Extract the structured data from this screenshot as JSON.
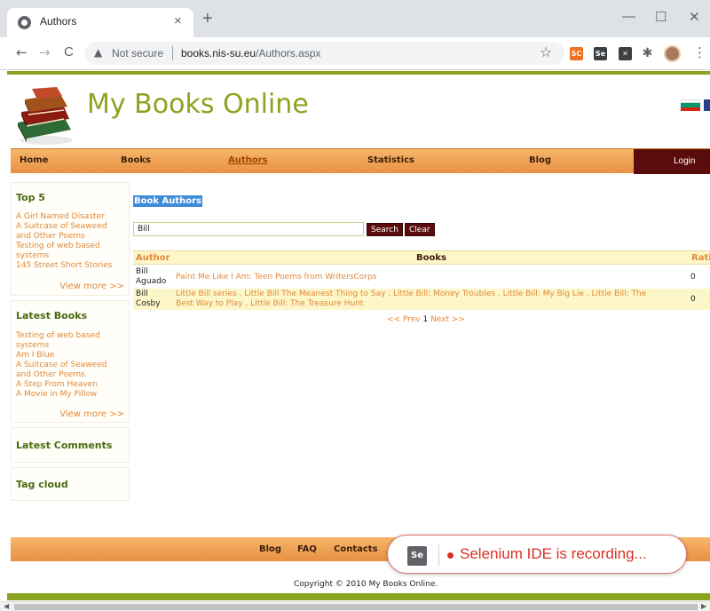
{
  "browser": {
    "tab_title": "Authors",
    "tab_close": "×",
    "new_tab": "+",
    "win_minimize": "—",
    "win_maximize": "☐",
    "win_close": "✕",
    "back": "←",
    "forward": "→",
    "reload": "C",
    "security_label": "Not secure",
    "url_host": "books.nis-su.eu",
    "url_path": "/Authors.aspx",
    "extensions": [
      {
        "name": "sc-extension-icon",
        "label": "SC",
        "color": "#f36f21"
      },
      {
        "name": "selenium-extension-icon",
        "label": "Se",
        "color": "#3c4043"
      },
      {
        "name": "x-extension-icon",
        "label": "✕",
        "color": "#3c4043"
      }
    ]
  },
  "site": {
    "title": "My Books Online",
    "accent_color": "#8aa422"
  },
  "nav": {
    "items": [
      "Home",
      "Books",
      "Authors",
      "Statistics",
      "Blog"
    ],
    "active": "Authors",
    "login": "Login"
  },
  "sidebar": {
    "top5": {
      "title": "Top 5",
      "links": [
        "A Girl Named Disaster",
        "A Suitcase of Seaweed",
        "and Other Poems",
        "Testing of web based",
        "systems",
        "145 Street Short Stories"
      ],
      "view_more": "View more >>"
    },
    "latest_books": {
      "title": "Latest Books",
      "links": [
        "Testing of web based",
        "systems",
        "Am I Blue",
        "A Suitcase of Seaweed",
        "and Other Poems",
        "A Step From Heaven",
        "A Movie in My Pillow"
      ],
      "view_more": "View more >>"
    },
    "latest_comments": {
      "title": "Latest Comments"
    },
    "tag_cloud": {
      "title": "Tag cloud"
    }
  },
  "main": {
    "title": "Book Authors",
    "search_value": "Bill",
    "search_button": "Search",
    "clear_button": "Clear",
    "columns": {
      "author": "Author",
      "books": "Books",
      "rating": "Rati"
    },
    "rows": [
      {
        "author_line1": "Bill",
        "author_line2": "Aguado",
        "books_line1": "Paint Me Like I Am: Teen Poems from WritersCorps",
        "books_line2": "",
        "rating": "0"
      },
      {
        "author_line1": "Bill",
        "author_line2": "Cosby",
        "books_line1": "Little Bill series , Little Bill The Meanest Thing to Say , Little Bill: Money Troubles , Little Bill: My Big Lie , Little Bill: The",
        "books_line2": "Best Way to Play , Little Bill: The Treasure Hunt",
        "rating": "0"
      }
    ],
    "pager": {
      "prev": "<< Prev",
      "current": "1",
      "next": "Next >>"
    }
  },
  "footer": {
    "links": [
      "Blog",
      "FAQ",
      "Contacts"
    ],
    "copyright": "Copyright © 2010 My Books Online."
  },
  "selenium": {
    "logo": "Se",
    "status": "Selenium IDE is recording..."
  }
}
